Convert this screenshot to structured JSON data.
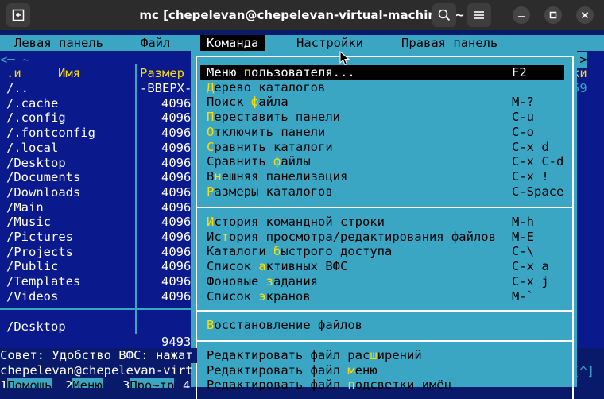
{
  "window": {
    "title": "mc [chepelevan@chepelevan-virtual-machine]:~",
    "newtab_icon": "new-tab-icon",
    "search_icon": "search-icon",
    "menu_icon": "hamburger-icon"
  },
  "menubar": {
    "left_panel": "Левая панель",
    "file": "Файл",
    "command": "Команда",
    "options": "Настройки",
    "right_panel": "Правая панель"
  },
  "left_panel": {
    "path_header": "<─ ~",
    "col_sort": ".и",
    "col_name": "Имя",
    "col_size": "Размер",
    "rows": [
      {
        "name": "/..",
        "size": "-ВВЕРХ-"
      },
      {
        "name": "/.cache",
        "size": "4096"
      },
      {
        "name": "/.config",
        "size": "4096"
      },
      {
        "name": "/.fontconfig",
        "size": "4096"
      },
      {
        "name": "/.local",
        "size": "4096"
      },
      {
        "name": "/Desktop",
        "size": "4096"
      },
      {
        "name": "/Documents",
        "size": "4096"
      },
      {
        "name": "/Downloads",
        "size": "4096"
      },
      {
        "name": "/Main",
        "size": "4096"
      },
      {
        "name": "/Music",
        "size": "4096"
      },
      {
        "name": "/Pictures",
        "size": "4096"
      },
      {
        "name": "/Projects",
        "size": "4096"
      },
      {
        "name": "/Public",
        "size": "4096"
      },
      {
        "name": "/Templates",
        "size": "4096"
      },
      {
        "name": "/Videos",
        "size": "4096"
      }
    ],
    "status_name": "/Desktop",
    "free_space": "9493"
  },
  "right_strip": {
    "arrow": "]>",
    "frag1": "ки",
    "frag2": "59",
    "bottom": "[^]"
  },
  "command_menu": {
    "group1": [
      {
        "pre": "Меню ",
        "hk": "п",
        "post": "ользователя...",
        "shortcut": "F2"
      },
      {
        "pre": "",
        "hk": "Д",
        "post": "ерево каталогов",
        "shortcut": ""
      },
      {
        "pre": "Поиск ",
        "hk": "ф",
        "post": "айла",
        "shortcut": "M-?"
      },
      {
        "pre": "",
        "hk": "П",
        "post": "ереставить панели",
        "shortcut": "C-u"
      },
      {
        "pre": "",
        "hk": "О",
        "post": "тключить панели",
        "shortcut": "C-o"
      },
      {
        "pre": "",
        "hk": "С",
        "post": "равнить каталоги",
        "shortcut": "C-x d"
      },
      {
        "pre": "Сравнить ",
        "hk": "ф",
        "post": "айлы",
        "shortcut": "C-x C-d"
      },
      {
        "pre": "В",
        "hk": "н",
        "post": "ешняя панелизация",
        "shortcut": "C-x !"
      },
      {
        "pre": "",
        "hk": "Р",
        "post": "азмеры каталогов",
        "shortcut": "C-Space"
      }
    ],
    "group2": [
      {
        "pre": "",
        "hk": "И",
        "post": "стория командной строки",
        "shortcut": "M-h"
      },
      {
        "pre": "Ис",
        "hk": "т",
        "post": "ория просмотра/редактирования файлов",
        "shortcut": "M-E"
      },
      {
        "pre": "Каталоги ",
        "hk": "б",
        "post": "ыстрого доступа",
        "shortcut": "C-\\"
      },
      {
        "pre": "Список ",
        "hk": "а",
        "post": "ктивных ВФС",
        "shortcut": "C-x a"
      },
      {
        "pre": "Фоновые ",
        "hk": "з",
        "post": "адания",
        "shortcut": "C-x j"
      },
      {
        "pre": "Список ",
        "hk": "э",
        "post": "кранов",
        "shortcut": "M-`"
      }
    ],
    "group3": [
      {
        "pre": "",
        "hk": "В",
        "post": "осстановление файлов",
        "shortcut": ""
      }
    ],
    "group4": [
      {
        "pre": "Редактировать файл рас",
        "hk": "ш",
        "post": "ирений",
        "shortcut": ""
      },
      {
        "pre": "Редактировать файл ",
        "hk": "м",
        "post": "еню",
        "shortcut": ""
      },
      {
        "pre": "Редактировать файл ",
        "hk": "п",
        "post": "одсветки имён",
        "shortcut": ""
      }
    ]
  },
  "hint": "Совет: Удобство ВФС: нажат",
  "prompt": "chepelevan@chepelevan-virt",
  "fkeys": [
    {
      "num": "1",
      "label": "Помощь"
    },
    {
      "num": "2",
      "label": "Меню"
    },
    {
      "num": "3",
      "label": "Про~тр"
    },
    {
      "num": "4",
      "label": ""
    }
  ],
  "colors": {
    "panel": "#0a1a8c",
    "menu": "#3aa6c4",
    "hotkey": "#ffdd00"
  }
}
